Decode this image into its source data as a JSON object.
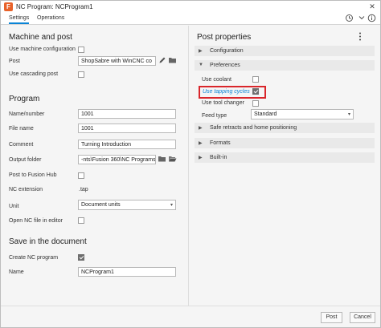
{
  "window": {
    "app_icon_letter": "F",
    "title": "NC Program: NCProgram1",
    "close_glyph": "✕"
  },
  "tabs": [
    {
      "label": "Settings",
      "active": true
    },
    {
      "label": "Operations",
      "active": false
    }
  ],
  "tab_icons": {
    "history": "history-icon",
    "info": "info-icon"
  },
  "left": {
    "machine_section": {
      "title": "Machine and post",
      "use_machine_config_label": "Use machine configuration",
      "post_label": "Post",
      "post_value": "ShopSabre with WinCNC co",
      "use_cascading_post_label": "Use cascading post"
    },
    "program_section": {
      "title": "Program",
      "name_number_label": "Name/number",
      "name_number_value": "1001",
      "file_name_label": "File name",
      "file_name_value": "1001",
      "comment_label": "Comment",
      "comment_value": "Turning Introduction",
      "output_folder_label": "Output folder",
      "output_folder_value": "-nts\\Fusion 360\\NC Programs",
      "post_to_hub_label": "Post to Fusion Hub",
      "nc_extension_label": "NC extension",
      "nc_extension_value": ".tap",
      "unit_label": "Unit",
      "unit_value": "Document units",
      "open_nc_label": "Open NC file in editor"
    },
    "save_section": {
      "title": "Save in the document",
      "create_nc_label": "Create NC program",
      "name_label": "Name",
      "name_value": "NCProgram1"
    }
  },
  "right": {
    "title": "Post properties",
    "groups": {
      "configuration": "Configuration",
      "preferences": "Preferences",
      "safe_retracts": "Safe retracts and home positioning",
      "formats": "Formats",
      "builtin": "Built-in"
    },
    "preferences": {
      "use_coolant_label": "Use coolant",
      "use_tapping_label": "Use tapping cycles",
      "use_tool_changer_label": "Use tool changer",
      "feed_type_label": "Feed type",
      "feed_type_value": "Standard"
    }
  },
  "footer": {
    "post_button": "Post",
    "cancel_button": "Cancel"
  },
  "colors": {
    "accent": "#0a84d6",
    "highlight_outline": "#d9262b",
    "app_icon": "#e8622a"
  }
}
